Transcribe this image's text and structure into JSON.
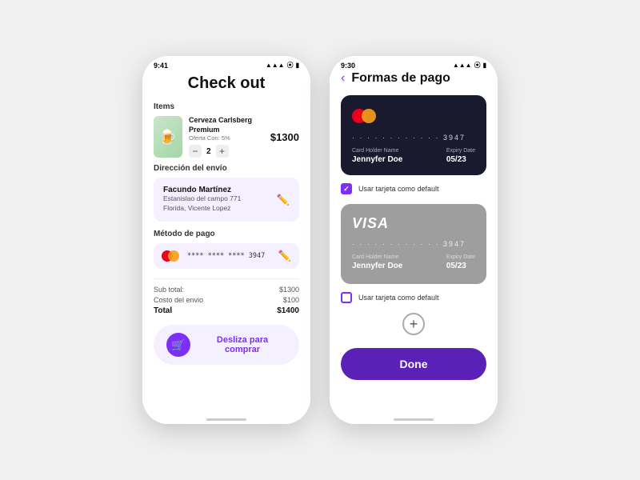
{
  "screen1": {
    "status_time": "9:41",
    "title": "Check out",
    "items_label": "Items",
    "item": {
      "name": "Cerveza Carlsberg Premium",
      "discount": "Oferta Con: 5%",
      "qty": "2",
      "price": "$1300",
      "emoji": "🍺"
    },
    "address_label": "Dirección del envío",
    "address": {
      "name": "Facundo Martínez",
      "street": "Estanislao del campo 771",
      "city": "Florida, Vicente Lopez"
    },
    "payment_label": "Método de pago",
    "payment": {
      "card_number": "**** **** **** 3947"
    },
    "summary": {
      "subtotal_label": "Sub total:",
      "subtotal_val": "$1300",
      "shipping_label": "Costo del envio",
      "shipping_val": "$100",
      "total_label": "Total",
      "total_val": "$1400"
    },
    "slider_text": "Desliza para comprar"
  },
  "screen2": {
    "status_time": "9:30",
    "title": "Formas de pago",
    "back_label": "‹",
    "card1": {
      "type": "mastercard",
      "dots": "· · · · · · · · · · · · 3947",
      "holder_label": "Card Holder Name",
      "holder_val": "Jennyfer Doe",
      "expiry_label": "Expiry Date",
      "expiry_val": "05/23",
      "default_label": "Usar tarjeta como default",
      "checked": true
    },
    "card2": {
      "type": "visa",
      "dots": "· · · · · · · · · · · · 3947",
      "holder_label": "Card Holder Name",
      "holder_val": "Jennyfer Doe",
      "expiry_label": "Expiry Date",
      "expiry_val": "05/23",
      "default_label": "Usar tarjeta como default",
      "checked": false
    },
    "add_icon": "+",
    "done_label": "Done"
  }
}
